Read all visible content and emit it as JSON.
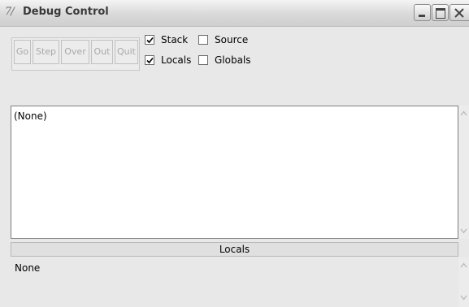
{
  "window": {
    "icon_text": "7/",
    "title": "Debug Control"
  },
  "toolbar": {
    "buttons": [
      {
        "label": "Go",
        "enabled": false
      },
      {
        "label": "Step",
        "enabled": false
      },
      {
        "label": "Over",
        "enabled": false
      },
      {
        "label": "Out",
        "enabled": false
      },
      {
        "label": "Quit",
        "enabled": false
      }
    ],
    "checkboxes": [
      {
        "label": "Stack",
        "checked": true
      },
      {
        "label": "Source",
        "checked": false
      },
      {
        "label": "Locals",
        "checked": true
      },
      {
        "label": "Globals",
        "checked": false
      }
    ]
  },
  "stack_panel": {
    "content": "(None)"
  },
  "locals_panel": {
    "header": "Locals",
    "content": "None"
  },
  "colors": {
    "window_bg": "#e8e8e8",
    "disabled_text": "#a8a8a8",
    "list_bg": "#ffffff"
  }
}
